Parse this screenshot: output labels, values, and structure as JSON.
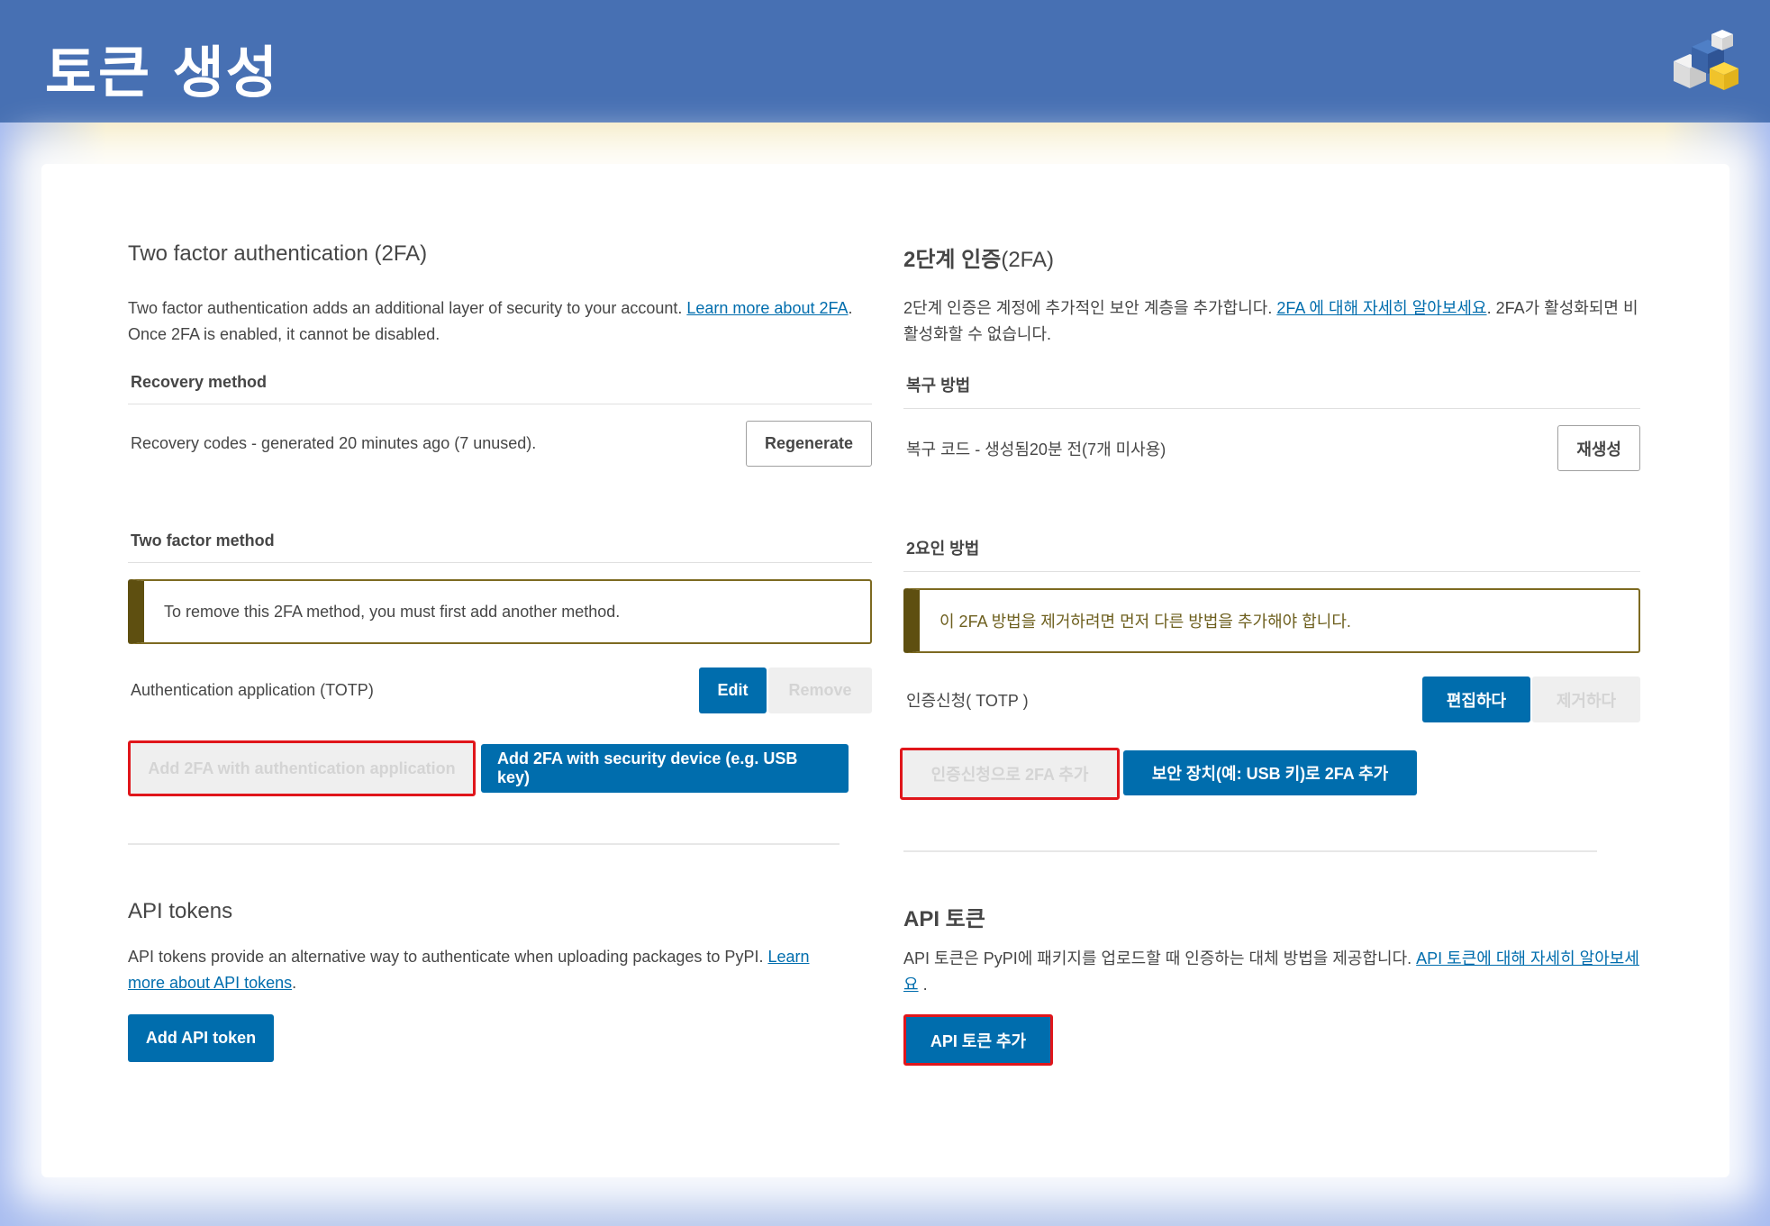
{
  "slide": {
    "title": "토큰 생성",
    "logo_icon": "python-package-cubes-icon"
  },
  "left": {
    "heading": "Two factor authentication (2FA)",
    "intro_text": "Two factor authentication adds an additional layer of security to your account.",
    "intro_link": "Learn more about 2FA",
    "intro_after": ". Once 2FA is enabled, it cannot be disabled.",
    "recovery_heading": "Recovery method",
    "recovery_text": "Recovery codes - generated 20 minutes ago (7 unused).",
    "regenerate_label": "Regenerate",
    "method_heading": "Two factor method",
    "callout_text": "To remove this 2FA method, you must first add another method.",
    "auth_app_text": "Authentication application (TOTP)",
    "edit_label": "Edit",
    "remove_label": "Remove",
    "add_app_label": "Add 2FA with authentication application",
    "add_device_label": "Add 2FA with security device (e.g. USB key)",
    "api_heading": "API tokens",
    "api_text": "API tokens provide an alternative way to authenticate when uploading packages to PyPI.",
    "api_link": "Learn more about API tokens",
    "api_after": ".",
    "add_token_label": "Add API token"
  },
  "right": {
    "heading_main": "2단계 인증",
    "heading_suffix": "(2FA)",
    "intro_text": "2단계 인증은 계정에 추가적인 보안 계층을 추가합니다.",
    "intro_link": "2FA 에 대해 자세히 알아보세요",
    "intro_after": ". 2FA가 활성화되면 비활성화할 수 없습니다.",
    "recovery_heading": "복구 방법",
    "recovery_text": "복구 코드 - 생성됨20분 전(7개 미사용)",
    "regenerate_label": "재생성",
    "method_heading": "2요인 방법",
    "callout_text": "이 2FA 방법을 제거하려면 먼저 다른 방법을 추가해야 합니다.",
    "auth_app_text": "인증신청( TOTP )",
    "edit_label": "편집하다",
    "remove_label": "제거하다",
    "add_app_label": "인증신청으로 2FA 추가",
    "add_device_label": "보안 장치(예: USB 키)로 2FA 추가",
    "api_heading": "API 토큰",
    "api_text": "API 토큰은 PyPI에 패키지를 업로드할 때 인증하는 대체 방법을 제공합니다.",
    "api_link": "API 토큰에 대해 자세히 알아보세요",
    "api_after": " .",
    "add_token_label": "API 토큰 추가"
  },
  "colors": {
    "header": "#4770b3",
    "pypi_blue": "#006dad",
    "highlight_red": "#e0161b",
    "callout_border": "#5e4f10"
  }
}
